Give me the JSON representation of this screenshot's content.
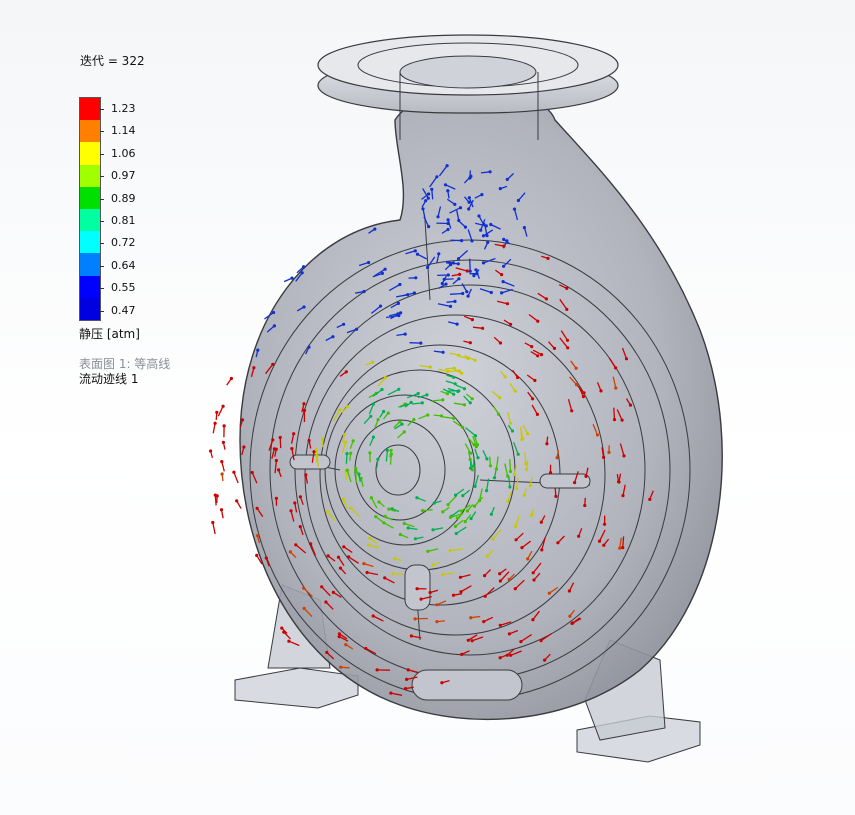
{
  "legend": {
    "iteration_label": "迭代 = 322",
    "ticks": [
      "1.23",
      "1.14",
      "1.06",
      "0.97",
      "0.89",
      "0.81",
      "0.72",
      "0.64",
      "0.55",
      "0.47"
    ],
    "colors": [
      "#ff0000",
      "#ff8000",
      "#ffff00",
      "#a0ff00",
      "#00e000",
      "#00ffa0",
      "#00ffff",
      "#0080ff",
      "#0000ff",
      "#0000e0"
    ],
    "unit_label": "静压 [atm]"
  },
  "plots": {
    "surface_plot": "表面图 1: 等高线",
    "flow_trajectory": "流动迹线 1"
  },
  "model": {
    "body_color": "#bcbfc8",
    "edge_color": "#3a3a40",
    "arrow_palette": [
      "#cc0000",
      "#d04000",
      "#c8c800",
      "#40c000",
      "#00b050",
      "#1030d0"
    ]
  }
}
